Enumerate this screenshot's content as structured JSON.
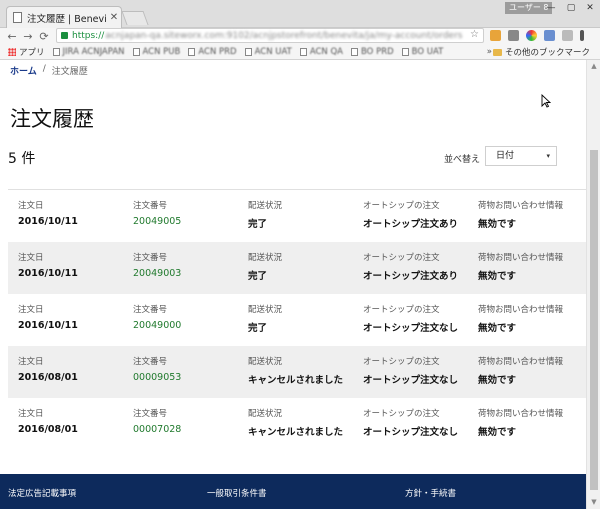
{
  "browser": {
    "tab_title": "注文履歴 | Benevita",
    "tab_close": "✕",
    "user_badge": "ユーザー 8",
    "url_scheme": "https://",
    "url_rest": "acnjapan-qa.siteworx.com:9102/acnjpstorefront/benevita/ja/my-account/orders",
    "star": "☆",
    "win_min": "—",
    "win_max": "▢",
    "win_close": "✕",
    "nav_back": "←",
    "nav_forward": "→",
    "nav_reload": "⟳"
  },
  "bookmarks": {
    "apps": "アプリ",
    "items": [
      "JIRA ACNJAPAN",
      "ACN PUB",
      "ACN PRD",
      "ACN UAT",
      "ACN QA",
      "BO PRD",
      "BO UAT"
    ],
    "more": "»",
    "other": "その他のブックマーク"
  },
  "page": {
    "breadcrumb_home": "ホーム",
    "breadcrumb_sep": "/",
    "breadcrumb_current": "注文履歴",
    "title": "注文履歴",
    "count": "5 件",
    "sort_label": "並べ替え",
    "sort_value": "日付",
    "sort_arrow": "▾"
  },
  "orders_labels": {
    "date": "注文日",
    "number": "注文番号",
    "status": "配送状況",
    "autoship": "オートシップの注文",
    "inquiry": "荷物お問い合わせ情報"
  },
  "orders": [
    {
      "date": "2016/10/11",
      "number": "20049005",
      "status": "完了",
      "autoship": "オートシップ注文あり",
      "inquiry": "無効です"
    },
    {
      "date": "2016/10/11",
      "number": "20049003",
      "status": "完了",
      "autoship": "オートシップ注文あり",
      "inquiry": "無効です"
    },
    {
      "date": "2016/10/11",
      "number": "20049000",
      "status": "完了",
      "autoship": "オートシップ注文なし",
      "inquiry": "無効です"
    },
    {
      "date": "2016/08/01",
      "number": "00009053",
      "status": "キャンセルされました",
      "autoship": "オートシップ注文なし",
      "inquiry": "無効です"
    },
    {
      "date": "2016/08/01",
      "number": "00007028",
      "status": "キャンセルされました",
      "autoship": "オートシップ注文なし",
      "inquiry": "無効です"
    }
  ],
  "footer": {
    "link1": "法定広告記載事項",
    "link2": "一般取引条件書",
    "link3": "方針・手続書"
  },
  "colors": {
    "accent": "#217a2e",
    "footer_bg": "#0d2a5c",
    "alt_row": "#efefef"
  }
}
